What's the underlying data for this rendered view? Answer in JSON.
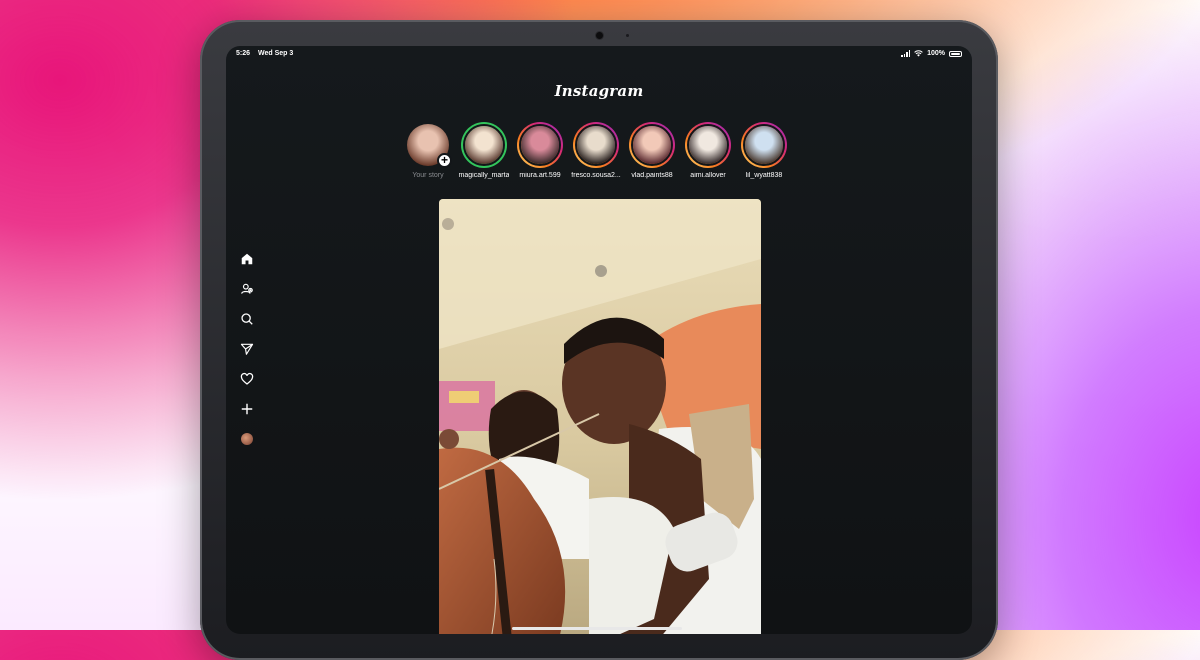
{
  "status_bar": {
    "time": "5:26",
    "date": "Wed Sep 3",
    "battery": "100%"
  },
  "app": {
    "title": "Instagram"
  },
  "stories": [
    {
      "name": "Your story",
      "own": true,
      "ring": "none",
      "tone": [
        "#e8c2b0",
        "#6a3a2a"
      ]
    },
    {
      "name": "magically_marta",
      "ring": "close-friends",
      "tone": [
        "#f3e3d0",
        "#5a3a30"
      ]
    },
    {
      "name": "miura.art.599",
      "ring": "gradient",
      "tone": [
        "#d98a9a",
        "#3a2a2a"
      ]
    },
    {
      "name": "fresco.sousa2...",
      "ring": "gradient",
      "tone": [
        "#e8dccc",
        "#2a2220"
      ]
    },
    {
      "name": "vlad.paints88",
      "ring": "gradient",
      "tone": [
        "#f2c9b8",
        "#5a2a30"
      ]
    },
    {
      "name": "aimi.allover",
      "ring": "gradient",
      "tone": [
        "#f0e8e0",
        "#3a3030"
      ]
    },
    {
      "name": "lil_wyatt838",
      "ring": "gradient",
      "tone": [
        "#cfe0f0",
        "#4a3a30"
      ]
    }
  ],
  "sidebar": [
    {
      "id": "home",
      "icon": "home-icon"
    },
    {
      "id": "reels",
      "icon": "friends-icon"
    },
    {
      "id": "search",
      "icon": "search-icon"
    },
    {
      "id": "messages",
      "icon": "send-icon"
    },
    {
      "id": "activity",
      "icon": "heart-icon"
    },
    {
      "id": "create",
      "icon": "plus-icon"
    },
    {
      "id": "profile",
      "icon": "profile-avatar"
    }
  ],
  "colors": {
    "gradient_ring": [
      "#feda75",
      "#fa7e1e",
      "#d62976",
      "#962fbf"
    ],
    "close_friends_ring": "#33c55c",
    "background": "#121517"
  }
}
